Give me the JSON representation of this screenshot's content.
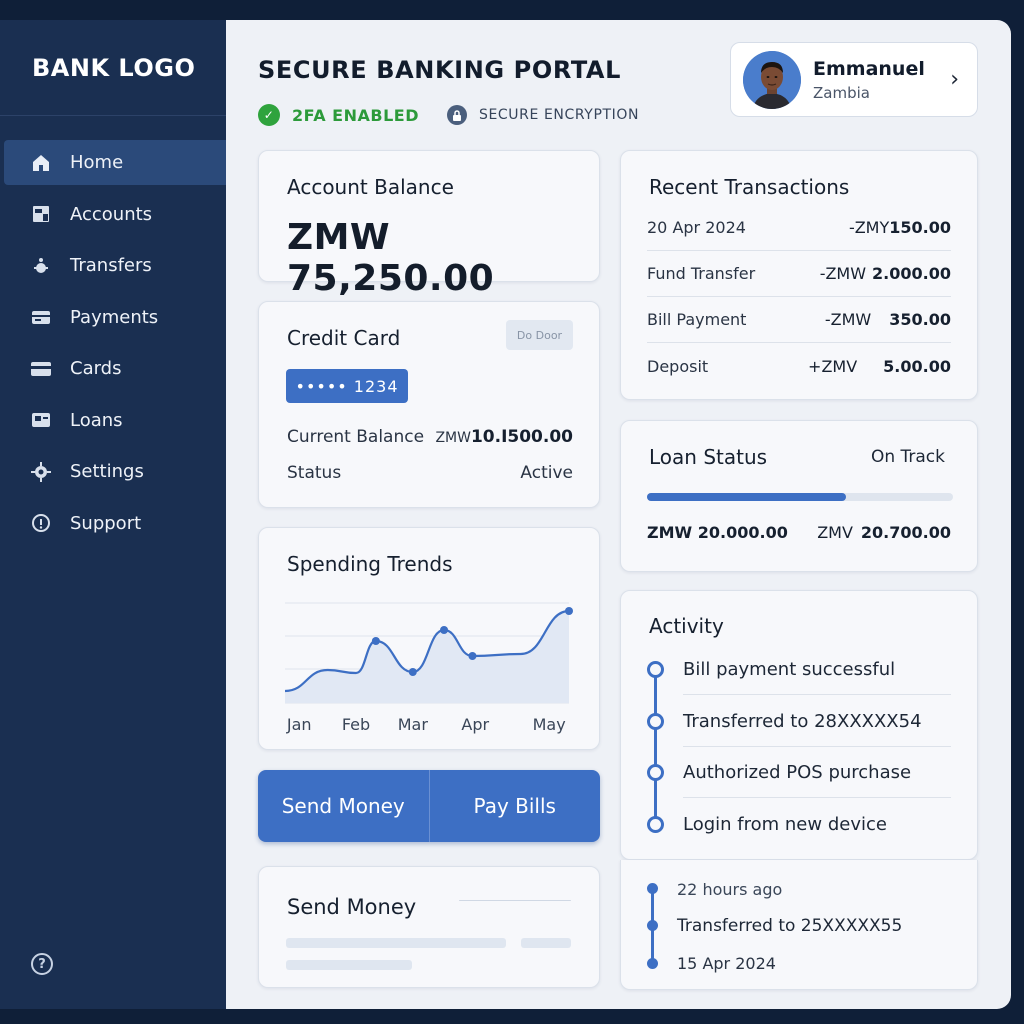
{
  "sidebar": {
    "logo": "BANK LOGO",
    "items": [
      {
        "label": "Home",
        "icon": "home-icon"
      },
      {
        "label": "Accounts",
        "icon": "accounts-icon"
      },
      {
        "label": "Transfers",
        "icon": "transfers-icon"
      },
      {
        "label": "Payments",
        "icon": "payments-icon"
      },
      {
        "label": "Cards",
        "icon": "cards-icon"
      },
      {
        "label": "Loans",
        "icon": "loans-icon"
      },
      {
        "label": "Settings",
        "icon": "gear-icon"
      },
      {
        "label": "Support",
        "icon": "support-icon"
      }
    ],
    "active_item": "Home",
    "help_icon": "?"
  },
  "header": {
    "title": "SECURE BANKING PORTAL",
    "twofa": "2FA ENABLED",
    "encryption": "SECURE ENCRYPTION"
  },
  "user": {
    "name": "Emmanuel",
    "country": "Zambia"
  },
  "balance": {
    "title": "Account Balance",
    "amount": "ZMW 75,250.00"
  },
  "credit_card": {
    "title": "Credit Card",
    "logo_text": "Do Door",
    "number": "••••• 1234",
    "current_balance_label": "Current Balance",
    "current_balance_currency": "ZMW",
    "current_balance_value": "10.I500.00",
    "status_label": "Status",
    "status_value": "Active"
  },
  "spending": {
    "title": "Spending Trends"
  },
  "chart_data": {
    "type": "area",
    "title": "Spending Trends",
    "categories": [
      "Jan",
      "Feb",
      "Mar",
      "Apr",
      "May"
    ],
    "x": [
      0,
      0.15,
      0.25,
      0.32,
      0.45,
      0.56,
      0.66,
      0.83,
      1.0
    ],
    "values": [
      0.12,
      0.33,
      0.3,
      0.62,
      0.31,
      0.73,
      0.47,
      0.49,
      0.92
    ],
    "ylim": [
      0,
      1
    ],
    "grid": true
  },
  "actions": {
    "send_money": "Send Money",
    "pay_bills": "Pay Bills"
  },
  "send_money_panel": {
    "title": "Send Money"
  },
  "transactions": {
    "title": "Recent Transactions",
    "rows": [
      {
        "label": "20 Apr 2024",
        "currency": "-ZMY",
        "amount": "150.00"
      },
      {
        "label": "Fund Transfer",
        "currency": "-ZMW",
        "amount": "2.000.00"
      },
      {
        "label": "Bill Payment",
        "currency": "-ZMW",
        "amount": "350.00"
      },
      {
        "label": "Deposit",
        "currency": "+ZMV",
        "amount": "5.00.00"
      }
    ]
  },
  "loan": {
    "title": "Loan Status",
    "status": "On Track",
    "progress": 0.65,
    "paid": "ZMW 20.000.00",
    "total_currency": "ZMV",
    "total_amount": "20.700.00"
  },
  "activity": {
    "title": "Activity",
    "items": [
      "Bill payment successful",
      "Transferred to 28XXXXX54",
      "Authorized POS purchase",
      "Login from new device"
    ]
  },
  "activity_extra": {
    "time": "22 hours ago",
    "item": "Transferred to 25XXXXX55",
    "date": "15 Apr 2024"
  }
}
